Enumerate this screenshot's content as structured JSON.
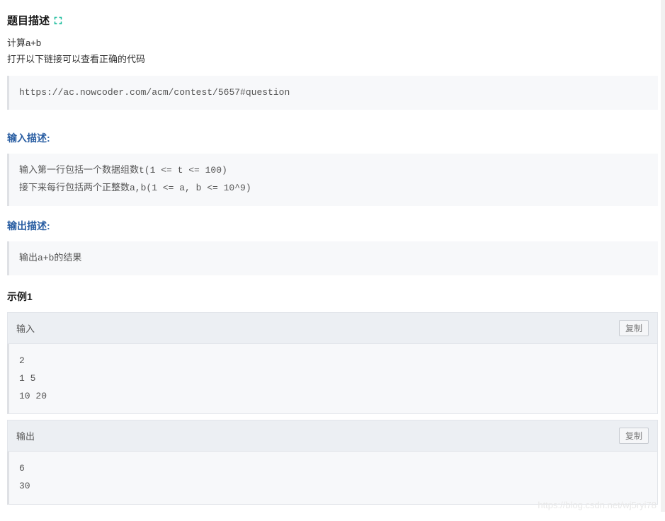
{
  "title": "题目描述",
  "desc_lines": [
    "计算a+b",
    "打开以下链接可以查看正确的代码"
  ],
  "link_block": "https://ac.nowcoder.com/acm/contest/5657#question",
  "input_section": {
    "header": "输入描述:",
    "body": "输入第一行包括一个数据组数t(1 <= t <= 100)\n接下来每行包括两个正整数a,b(1 <= a, b <= 10^9)"
  },
  "output_section": {
    "header": "输出描述:",
    "body": "输出a+b的结果"
  },
  "sample": {
    "title": "示例1",
    "input_label": "输入",
    "input_body": "2\n1 5\n10 20",
    "output_label": "输出",
    "output_body": "6\n30",
    "copy_label": "复制"
  },
  "watermark": "https://blog.csdn.net/wj5ryi78"
}
